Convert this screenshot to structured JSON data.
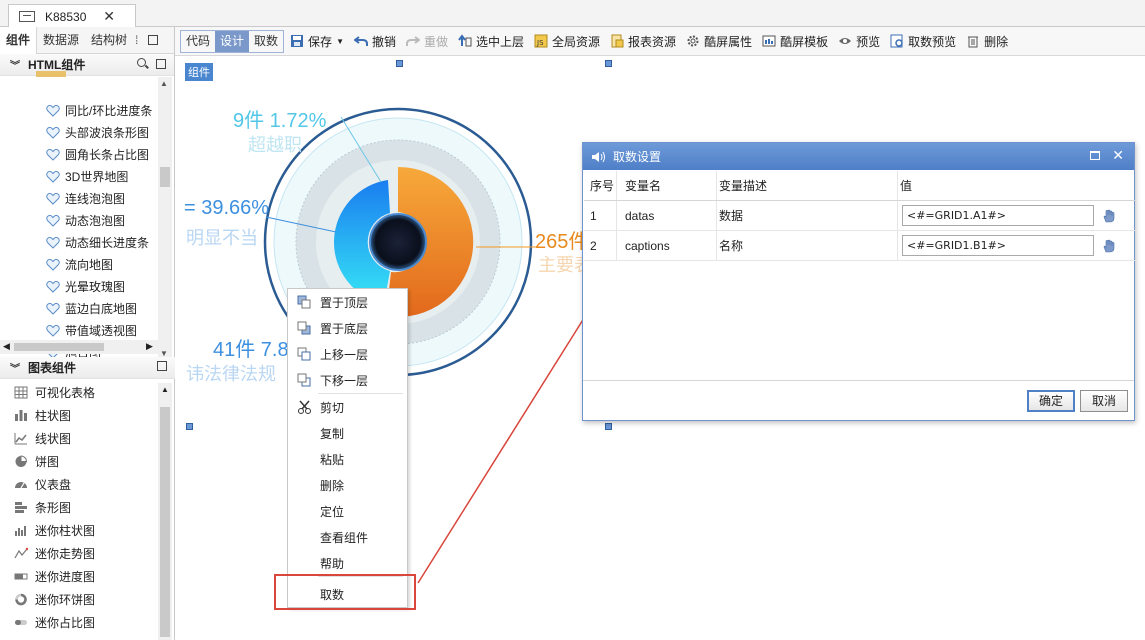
{
  "tabbar": {
    "doc_title": "K88530",
    "close": "✕"
  },
  "left_tabs": [
    "组件",
    "数据源",
    "结构树"
  ],
  "html_panel": {
    "title": "HTML组件",
    "items": [
      "同比/环比进度条",
      "头部波浪条形图",
      "圆角长条占比图",
      "3D世界地图",
      "连线泡泡图",
      "动态泡泡图",
      "动态细长进度条",
      "流向地图",
      "光晕玫瑰图",
      "蓝边白底地图",
      "带值域透视图",
      "旭日图"
    ]
  },
  "chart_panel": {
    "title": "图表组件",
    "items": [
      {
        "label": "可视化表格",
        "icon": "table-icon"
      },
      {
        "label": "柱状图",
        "icon": "bar-chart-icon"
      },
      {
        "label": "线状图",
        "icon": "line-chart-icon"
      },
      {
        "label": "饼图",
        "icon": "pie-chart-icon"
      },
      {
        "label": "仪表盘",
        "icon": "gauge-icon"
      },
      {
        "label": "条形图",
        "icon": "hbar-chart-icon"
      },
      {
        "label": "迷你柱状图",
        "icon": "mini-bar-icon"
      },
      {
        "label": "迷你走势图",
        "icon": "mini-trend-icon"
      },
      {
        "label": "迷你进度图",
        "icon": "mini-progress-icon"
      },
      {
        "label": "迷你环饼图",
        "icon": "mini-ring-icon"
      },
      {
        "label": "迷你占比图",
        "icon": "mini-ratio-icon"
      }
    ]
  },
  "toolbar": {
    "modes": [
      "代码",
      "设计",
      "取数"
    ],
    "active_mode": "设计",
    "save": "保存",
    "undo": "撤销",
    "redo": "重做",
    "select_up": "选中上层",
    "global_res": "全局资源",
    "report_res": "报表资源",
    "screen_props": "酷屏属性",
    "screen_tpl": "酷屏模板",
    "preview": "预览",
    "data_preview": "取数预览",
    "delete": "删除"
  },
  "canvas": {
    "component_label": "组件",
    "labels": {
      "top_value": "9件 1.72%",
      "top_sub": "超越职",
      "left_value": "= 39.66%",
      "left_sub": "明显不当",
      "bottom_value": "41件 7.8",
      "bottom_sub": "讳法律法规",
      "right_value": "265件",
      "right_sub": "主要表"
    }
  },
  "context_menu": {
    "items": [
      "置于顶层",
      "置于底层",
      "上移一层",
      "下移一层",
      "剪切",
      "复制",
      "粘贴",
      "删除",
      "定位",
      "查看组件",
      "帮助",
      "取数"
    ]
  },
  "dialog": {
    "title": "取数设置",
    "columns": [
      "序号",
      "变量名",
      "变量描述",
      "值"
    ],
    "rows": [
      {
        "no": "1",
        "name": "datas",
        "desc": "数据",
        "value": "<#=GRID1.A1#>"
      },
      {
        "no": "2",
        "name": "captions",
        "desc": "名称",
        "value": "<#=GRID1.B1#>"
      }
    ],
    "ok": "确定",
    "cancel": "取消"
  },
  "colors": {
    "accent": "#4a86d0",
    "annotation_red": "#d9463b",
    "ring_orange": "#f29a22",
    "ring_blue": "#1e90ff",
    "ring_cyan": "#33e0f0"
  }
}
